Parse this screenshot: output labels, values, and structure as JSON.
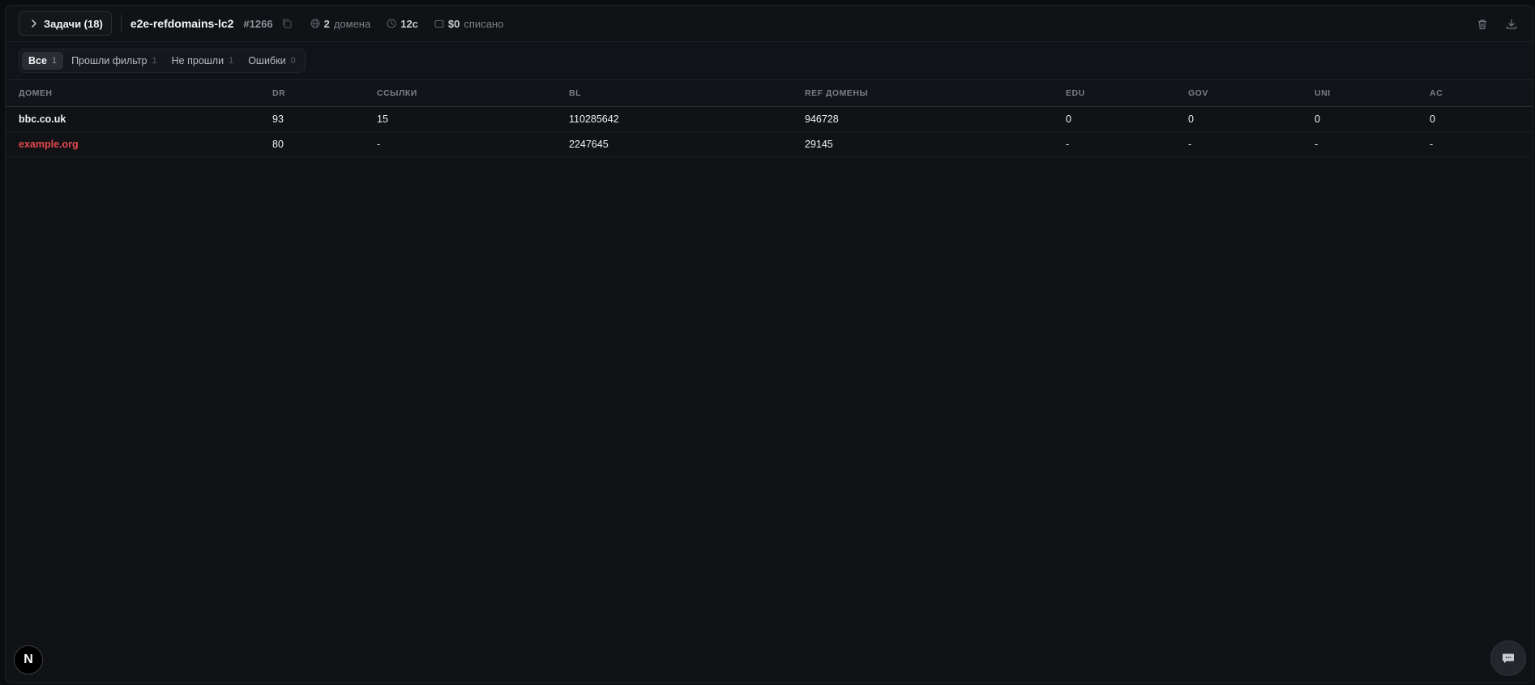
{
  "header": {
    "back_label": "Задачи (18)",
    "task_name": "e2e-refdomains-lc2",
    "task_id": "#1266",
    "domains_count": "2",
    "domains_label": "домена",
    "duration": "12с",
    "cost": "$0",
    "cost_label": "списано"
  },
  "tabs": [
    {
      "label": "Все",
      "count": "1"
    },
    {
      "label": "Прошли фильтр",
      "count": "1"
    },
    {
      "label": "Не прошли",
      "count": "1"
    },
    {
      "label": "Ошибки",
      "count": "0"
    }
  ],
  "table": {
    "columns": [
      "ДОМЕН",
      "DR",
      "ССЫЛКИ",
      "BL",
      "REF ДОМЕНЫ",
      "EDU",
      "GOV",
      "UNI",
      "AC"
    ],
    "rows": [
      [
        "bbc.co.uk",
        "93",
        "15",
        "110285642",
        "946728",
        "0",
        "0",
        "0",
        "0"
      ],
      [
        "example.org",
        "80",
        "-",
        "2247645",
        "29145",
        "-",
        "-",
        "-",
        "-"
      ]
    ]
  },
  "badge": {
    "letter": "N"
  },
  "colors": {
    "accent_error": "#e5484d",
    "background": "#101216"
  },
  "icons": [
    "chevron-right-icon",
    "copy-icon",
    "globe-icon",
    "clock-icon",
    "wallet-icon",
    "trash-icon",
    "download-icon",
    "chat-icon"
  ]
}
